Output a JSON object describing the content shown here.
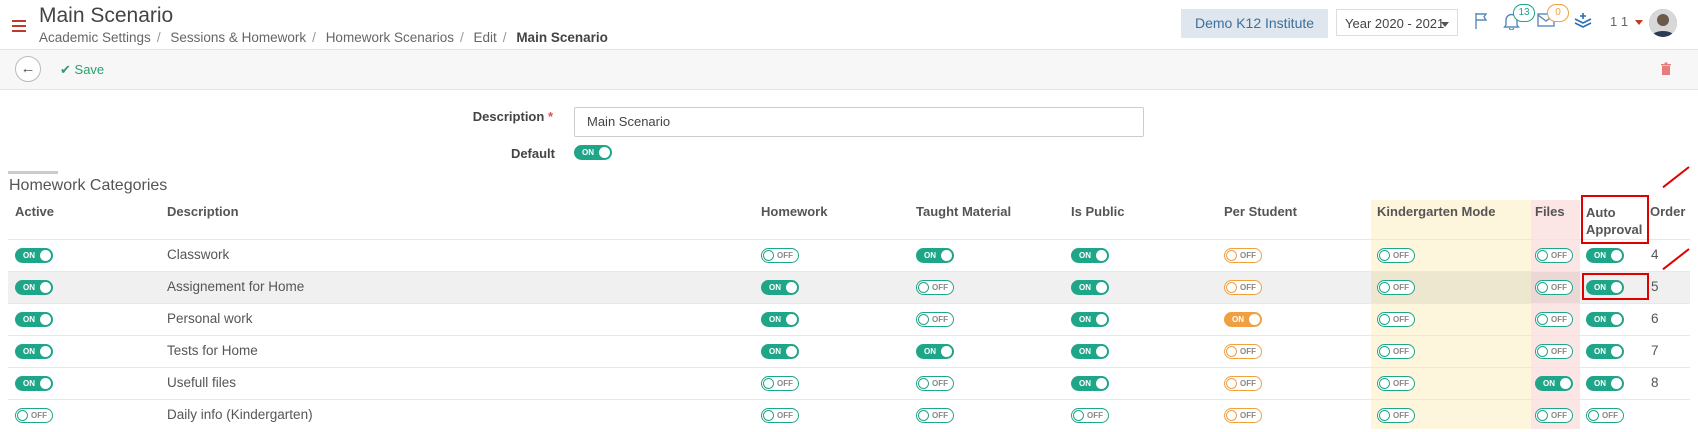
{
  "header": {
    "title": "Main Scenario",
    "breadcrumb": [
      "Academic Settings",
      "Sessions & Homework",
      "Homework Scenarios",
      "Edit",
      "Main Scenario"
    ],
    "institute": "Demo K12 Institute",
    "year": "Year 2020 - 2021",
    "notifications_count": "13",
    "messages_count": "0",
    "user_label": "1 1"
  },
  "toolbar": {
    "save_label": "Save"
  },
  "form": {
    "description_label": "Description",
    "required_mark": "*",
    "description_value": "Main Scenario",
    "default_label": "Default",
    "default_toggle": "ON"
  },
  "section_title": "Homework Categories",
  "columns": {
    "active": "Active",
    "description": "Description",
    "homework": "Homework",
    "taught": "Taught Material",
    "public": "Is Public",
    "per_student": "Per Student",
    "kindergarten": "Kindergarten Mode",
    "files": "Files",
    "auto_approval_1": "Auto",
    "auto_approval_2": "Approval",
    "order": "Order"
  },
  "rows": [
    {
      "description": "Classwork",
      "active": "ON",
      "homework": "OFF",
      "taught": "ON",
      "public": "ON",
      "per_student": "OFF",
      "kindergarten": "OFF",
      "files": "OFF",
      "auto_approval": "ON",
      "order": "4"
    },
    {
      "description": "Assignement for Home",
      "active": "ON",
      "homework": "ON",
      "taught": "OFF",
      "public": "ON",
      "per_student": "OFF",
      "kindergarten": "OFF",
      "files": "OFF",
      "auto_approval": "ON",
      "order": "5"
    },
    {
      "description": "Personal work",
      "active": "ON",
      "homework": "ON",
      "taught": "OFF",
      "public": "ON",
      "per_student": "ON",
      "kindergarten": "OFF",
      "files": "OFF",
      "auto_approval": "ON",
      "order": "6"
    },
    {
      "description": "Tests for Home",
      "active": "ON",
      "homework": "ON",
      "taught": "ON",
      "public": "ON",
      "per_student": "OFF",
      "kindergarten": "OFF",
      "files": "OFF",
      "auto_approval": "ON",
      "order": "7"
    },
    {
      "description": "Usefull files",
      "active": "ON",
      "homework": "OFF",
      "taught": "OFF",
      "public": "ON",
      "per_student": "OFF",
      "kindergarten": "OFF",
      "files": "ON",
      "auto_approval": "ON",
      "order": "8"
    },
    {
      "description": "Daily info (Kindergarten)",
      "active": "OFF",
      "homework": "OFF",
      "taught": "OFF",
      "public": "OFF",
      "per_student": "OFF",
      "kindergarten": "OFF",
      "files": "OFF",
      "auto_approval": "OFF",
      "order": ""
    }
  ],
  "colors": {
    "accent": "#1fa588",
    "orange": "#f0a040",
    "annotation_red": "#e00000"
  }
}
